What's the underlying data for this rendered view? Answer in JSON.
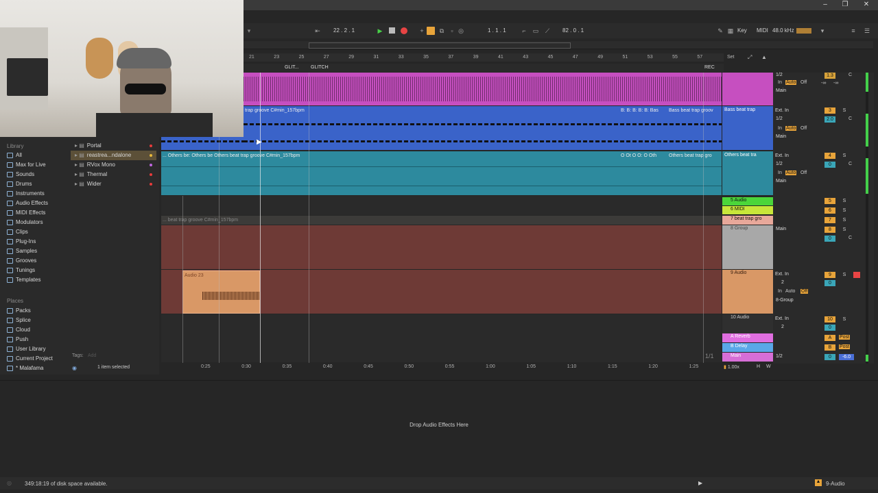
{
  "transport": {
    "position_left": "22 .  2 .  1",
    "position_main": "1 .  1 .  1",
    "tempo_field": "82 .  0 .  1",
    "key_label": "Key",
    "midi_label": "MIDI",
    "sample_rate": "48.0 kHz"
  },
  "ruler": {
    "bars": [
      "21",
      "23",
      "25",
      "27",
      "29",
      "31",
      "33",
      "35",
      "37",
      "39",
      "41",
      "43",
      "45",
      "47",
      "49",
      "51",
      "53",
      "55",
      "57"
    ],
    "set_label": "Set"
  },
  "time_ruler": {
    "ticks": [
      "0:25",
      "0:30",
      "0:35",
      "0:40",
      "0:45",
      "0:50",
      "0:55",
      "1:00",
      "1:05",
      "1:10",
      "1:15",
      "1:20",
      "1:25"
    ]
  },
  "locators": [
    "GLIT...",
    "GLITCH",
    "REC"
  ],
  "browser": {
    "library_heading": "Library",
    "categories": [
      "All",
      "Max for Live",
      "Sounds",
      "Drums",
      "Instruments",
      "Audio Effects",
      "MIDI Effects",
      "Modulators",
      "Clips",
      "Plug-Ins",
      "Samples",
      "Grooves",
      "Tunings",
      "Templates"
    ],
    "places_heading": "Places",
    "places": [
      "Packs",
      "Splice",
      "Cloud",
      "Push",
      "User Library",
      "Current Project",
      "* Malafama"
    ],
    "devices": [
      {
        "label": "Portal",
        "dot": "#e83b3b"
      },
      {
        "label": "reastrea...ndalone",
        "dot": "#e8b83b"
      },
      {
        "label": "RVox Mono",
        "dot": "#c067e0"
      },
      {
        "label": "Thermal",
        "dot": "#e83b3b"
      },
      {
        "label": "Wider",
        "dot": "#e83b3b"
      }
    ],
    "tags_label": "Tags:",
    "tags_placeholder": "Add",
    "selection_status": "1 item selected"
  },
  "tracks": {
    "clip_bass_left": "trap groove C#min_157bpm",
    "clip_bass_mid": "B: B: B: B: B: Bas",
    "clip_bass_right": "Bass beat trap groov",
    "clip_others_left": "... Others be: Others be Others beat trap groove C#min_157bpm",
    "clip_others_mid": "O Ot O O: O Oth",
    "clip_others_right": "Others beat trap gro",
    "clip_group_faded": "... beat trap groove C#min_157bpm",
    "clip_audio23": "Audio 23",
    "loop_indicator": "1/1"
  },
  "track_headers": [
    {
      "name": "",
      "color": "#c64fc0"
    },
    {
      "name": "Bass beat trap",
      "color": "#3a63c9"
    },
    {
      "name": "Others beat tra",
      "color": "#2d8a9e"
    },
    {
      "name": "5 Audio",
      "color": "#4bd63a"
    },
    {
      "name": "6 MIDI",
      "color": "#c8e63a"
    },
    {
      "name": "7 beat trap gro",
      "color": "#e8a89a"
    },
    {
      "name": "8 Group",
      "color": "#a8a8a8"
    },
    {
      "name": "9 Audio",
      "color": "#d99866"
    },
    {
      "name": "10 Audio",
      "color": "#2f2f2f"
    },
    {
      "name": "A Reverb",
      "color": "#e06ee0"
    },
    {
      "name": "B Delay",
      "color": "#5aa7e8"
    },
    {
      "name": "Main",
      "color": "#d66ed6"
    }
  ],
  "mixer": {
    "ext_in": "Ext. In",
    "half": "1/2",
    "two": "2",
    "in": "In",
    "auto": "Auto",
    "off": "Off",
    "main": "Main",
    "group_route": "8-Group",
    "inf": "-∞",
    "track_numbers": [
      "3",
      "4",
      "5",
      "6",
      "7",
      "8",
      "9",
      "10",
      "A",
      "B",
      "1/2"
    ],
    "post": "Post",
    "vol_values": [
      "1.3",
      "2.0",
      "0",
      "0",
      "0",
      "0",
      "0",
      "-6.0"
    ],
    "c": "C",
    "s": "S"
  },
  "arr_footer": {
    "zoom": "1.00x",
    "h": "H",
    "w": "W"
  },
  "device_view": {
    "drop_text": "Drop Audio Effects Here"
  },
  "status": {
    "disk_space": "349:18:19 of disk space available.",
    "selected_track": "9-Audio"
  }
}
